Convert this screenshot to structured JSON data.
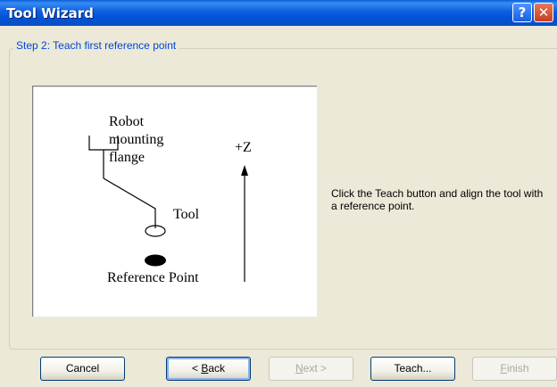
{
  "window": {
    "title": "Tool Wizard",
    "help_glyph": "?",
    "close_glyph": "✕"
  },
  "step": {
    "legend": "Step 2: Teach first reference point"
  },
  "diagram": {
    "flange_label_lines": [
      "Robot",
      "mounting",
      "flange"
    ],
    "tool_label": "Tool",
    "axis_label": "+Z",
    "reference_label": "Reference Point"
  },
  "instruction": "Click the Teach button and align the tool with a reference point.",
  "buttons": {
    "cancel": "Cancel",
    "back_mnemonic": "B",
    "back_rest": "ack",
    "back_prefix": "< ",
    "next_mnemonic": "N",
    "next_rest": "ext >",
    "teach": "Teach...",
    "finish_mnemonic": "F",
    "finish_rest": "inish"
  }
}
